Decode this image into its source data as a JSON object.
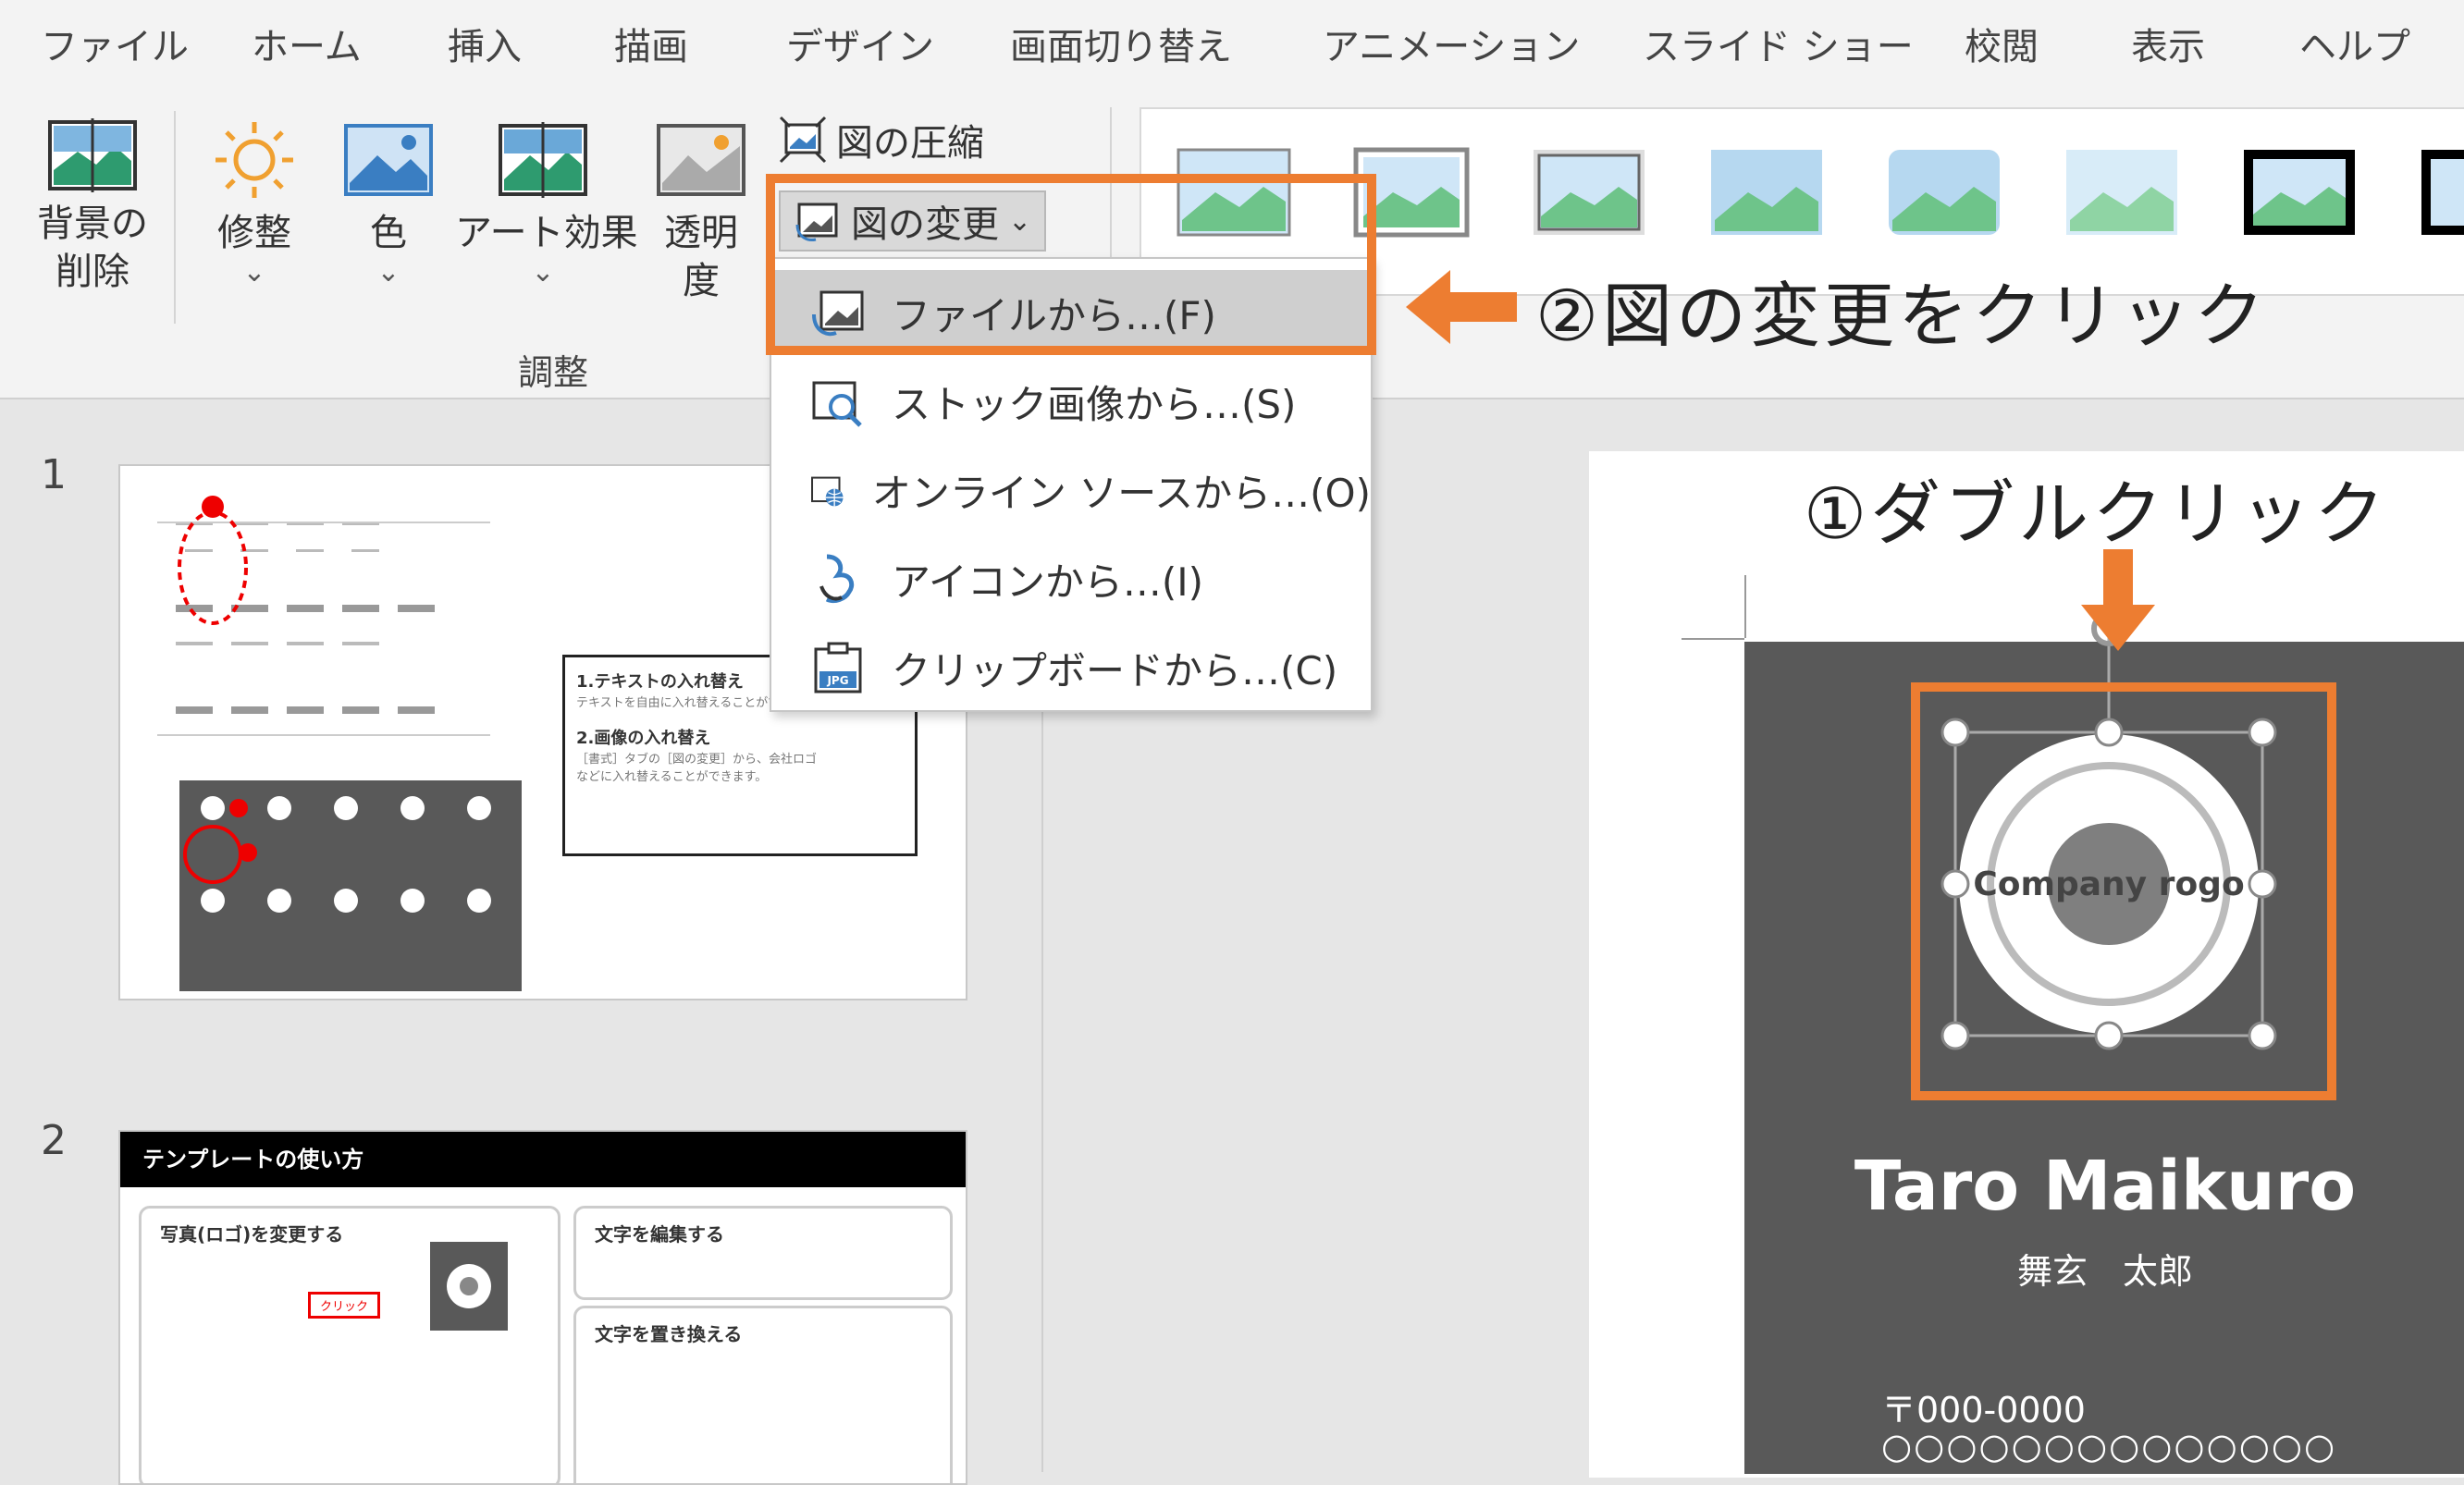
{
  "tabs": [
    "ファイル",
    "ホーム",
    "挿入",
    "描画",
    "デザイン",
    "画面切り替え",
    "アニメーション",
    "スライド ショー",
    "校閲",
    "表示",
    "ヘルプ"
  ],
  "ribbon": {
    "remove_bg": "背景の\n削除",
    "corrections": "修整",
    "color": "色",
    "art_effects": "アート効果",
    "transparency": "透明\n度",
    "compress": "図の圧縮",
    "change_picture": "図の変更",
    "group_label": "調整"
  },
  "menu": {
    "items": [
      {
        "label": "ファイルから…(F)",
        "icon": "file-picture-icon"
      },
      {
        "label": "ストック画像から…(S)",
        "icon": "stock-image-icon"
      },
      {
        "label": "オンライン ソースから…(O)",
        "icon": "online-source-icon"
      },
      {
        "label": "アイコンから…(I)",
        "icon": "icons-icon"
      },
      {
        "label": "クリップボードから…(C)",
        "icon": "clipboard-icon"
      }
    ]
  },
  "annotations": {
    "step1": "①ダブルクリック",
    "step2": "②図の変更をクリック"
  },
  "slides_panel": {
    "slide1_num": "1",
    "slide2_num": "2",
    "slide1_box_line1": "1.テキストの入れ替え",
    "slide1_box_line2": "テキストを自由に入れ替えることができます。",
    "slide1_box_line3": "2.画像の入れ替え",
    "slide1_box_line4": "［書式］タブの［図の変更］から、会社ロゴ",
    "slide1_box_line5": "などに入れ替えることができます。",
    "slide2_title": "テンプレートの使い方",
    "slide2_sec1": "写真(ロゴ)を変更する",
    "slide2_sec2": "文字を編集する",
    "slide2_sec3": "文字を置き換える",
    "slide2_click": "クリック"
  },
  "card": {
    "logo_text": "Company rogo",
    "name_en": "Taro Maikuro",
    "name_jp": "舞玄　太郎",
    "postal": "〒000-0000",
    "address": "○○○○○○○○○○○○○○"
  },
  "colors": {
    "accent": "#ed7d31",
    "card_bg": "#595959",
    "ribbon_bg": "#f3f3f3",
    "hover": "#cfcfcf"
  }
}
